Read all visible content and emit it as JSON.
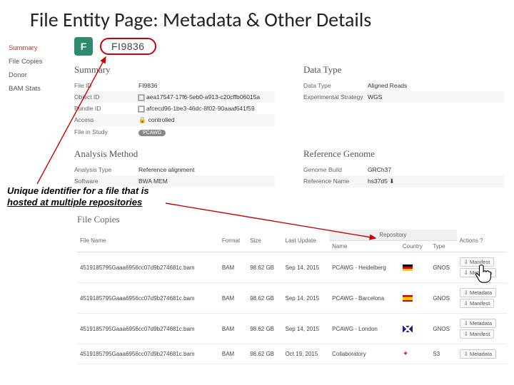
{
  "slide": {
    "title": "File Entity Page: Metadata & Other Details"
  },
  "file": {
    "icon_letter": "F",
    "id": "FI9836"
  },
  "sidebar": {
    "items": [
      {
        "label": "Summary",
        "active": true
      },
      {
        "label": "File Copies"
      },
      {
        "label": "Donor"
      },
      {
        "label": "BAM Stats"
      }
    ]
  },
  "summary_section": {
    "heading": "Summary",
    "rows": [
      {
        "k": "File ID",
        "v": "FI9836"
      },
      {
        "k": "Object ID",
        "v": "aea17547-17f6-5eb0-a913-c20cffb06015a",
        "copy": true
      },
      {
        "k": "Bundle ID",
        "v": "afcecd96-1be3-46dc-8f02-90aaaf641f59",
        "copy": true
      },
      {
        "k": "Access",
        "v": "controlled",
        "lock": true
      },
      {
        "k": "File in Study",
        "v": "PCAWG",
        "badge": true
      }
    ]
  },
  "data_type_section": {
    "heading": "Data Type",
    "rows": [
      {
        "k": "Data Type",
        "v": "Aligned Reads"
      },
      {
        "k": "Experimental Strategy",
        "v": "WGS"
      }
    ]
  },
  "analysis_section": {
    "heading": "Analysis Method",
    "rows": [
      {
        "k": "Analysis Type",
        "v": "Reference alignment"
      },
      {
        "k": "Software",
        "v": "BWA MEM"
      }
    ]
  },
  "reference_section": {
    "heading": "Reference Genome",
    "rows": [
      {
        "k": "Genome Build",
        "v": "GRCh37"
      },
      {
        "k": "Reference Name",
        "v": "hs37d5",
        "download": true
      }
    ]
  },
  "annotation": {
    "line1": "Unique identifier for a file that is",
    "line2": "hosted at multiple repositories"
  },
  "file_copies": {
    "heading": "File Copies",
    "columns": {
      "filename": "File Name",
      "format": "Format",
      "size": "Size",
      "last_update": "Last Update",
      "repo_group": "Repository",
      "repo_name": "Name",
      "repo_country": "Country",
      "repo_type": "Type",
      "actions": "Actions"
    },
    "rows": [
      {
        "filename": "4519185795Gaaa6956cc07d9b274681c.bam",
        "format": "BAM",
        "size": "98.62 GB",
        "last_update": "Sep 14, 2015",
        "repo_name": "PCAWG - Heidelberg",
        "flag": "de",
        "repo_type": "GNOS",
        "actions": [
          "Manifest",
          "Metadata"
        ]
      },
      {
        "filename": "4519185795Gaaa6956cc07d9b274681c.bam",
        "format": "BAM",
        "size": "98.62 GB",
        "last_update": "Sep 14, 2015",
        "repo_name": "PCAWG - Barcelona",
        "flag": "es",
        "repo_type": "GNOS",
        "actions": [
          "Metadata",
          "Manifest"
        ]
      },
      {
        "filename": "4519185795Gaaa6956cc07d9b274681c.bam",
        "format": "BAM",
        "size": "98.62 GB",
        "last_update": "Sep 14, 2015",
        "repo_name": "PCAWG - London",
        "flag": "uk",
        "repo_type": "GNOS",
        "actions": [
          "Metadata",
          "Manifest"
        ]
      },
      {
        "filename": "4519185795Gaaa6956cc07d9b274681c.bam",
        "format": "BAM",
        "size": "98.62 GB",
        "last_update": "Oct 19, 2015",
        "repo_name": "Collaboratory",
        "flag": "leaf",
        "repo_type": "S3",
        "actions": [
          "Metadata"
        ]
      }
    ]
  }
}
